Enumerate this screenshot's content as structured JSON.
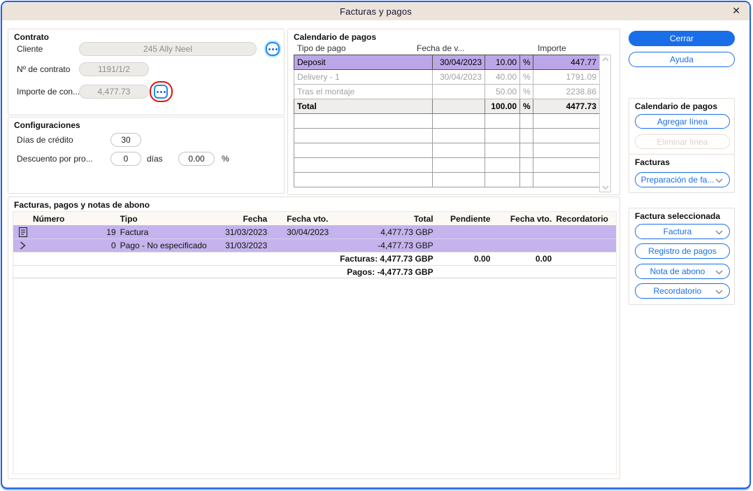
{
  "window": {
    "title": "Facturas y pagos"
  },
  "icons": {
    "close": "✕",
    "ellipsis_dots": "•••"
  },
  "contrato": {
    "label": "Contrato",
    "cliente": {
      "label": "Cliente",
      "value": "245 Ally Neel"
    },
    "num_contrato": {
      "label": "Nº de contrato",
      "value": "1191/1/2"
    },
    "importe": {
      "label": "Importe de con...",
      "value": "4,477.73"
    }
  },
  "configuraciones": {
    "label": "Configuraciones",
    "dias_credito": {
      "label": "Días de crédito",
      "value": "30"
    },
    "descuento": {
      "label": "Descuento por pro...",
      "dias": "0",
      "dias_suffix": "días",
      "pct": "0.00",
      "pct_suffix": "%"
    }
  },
  "calendario": {
    "label": "Calendario de pagos",
    "headers": {
      "tipo": "Tipo de pago",
      "fecha": "Fecha de v...",
      "importe": "Importe"
    },
    "rows": [
      {
        "tipo": "Deposit",
        "fecha": "30/04/2023",
        "pct": "10.00",
        "sign": "%",
        "importe": "447.77"
      },
      {
        "tipo": "Delivery - 1",
        "fecha": "30/04/2023",
        "pct": "40.00",
        "sign": "%",
        "importe": "1791.09"
      },
      {
        "tipo": "Tras el montaje",
        "fecha": "",
        "pct": "50.00",
        "sign": "%",
        "importe": "2238.86"
      },
      {
        "tipo": "Total",
        "fecha": "",
        "pct": "100.00",
        "sign": "%",
        "importe": "4477.73"
      }
    ]
  },
  "facturas": {
    "label": "Facturas, pagos y notas de abono",
    "headers": {
      "numero": "Número",
      "tipo": "Tipo",
      "fecha": "Fecha",
      "fecha_vto": "Fecha vto.",
      "total": "Total",
      "pendiente": "Pendiente",
      "fecha_vto2": "Fecha vto.",
      "recordatorio": "Recordatorio"
    },
    "rows": [
      {
        "numero": "19",
        "tipo": "Factura",
        "fecha": "31/03/2023",
        "fecha_vto": "30/04/2023",
        "total": "4,477.73 GBP"
      },
      {
        "numero": "0",
        "tipo": "Pago - No especificado",
        "fecha": "31/03/2023",
        "fecha_vto": "",
        "total": "-4,477.73 GBP"
      }
    ],
    "totals": [
      {
        "label": "Facturas: 4,477.73 GBP",
        "pendiente": "0.00",
        "fecha_vto": "0.00"
      },
      {
        "label": "Pagos: -4,477.73 GBP",
        "pendiente": "",
        "fecha_vto": ""
      }
    ]
  },
  "panel": {
    "cerrar": "Cerrar",
    "ayuda": "Ayuda",
    "calendario_group": {
      "label": "Calendario de pagos",
      "agregar": "Agregar línea",
      "eliminar": "Eliminar línea"
    },
    "facturas_group": {
      "label": "Facturas",
      "preparacion": "Preparación de fa..."
    },
    "seleccionada_group": {
      "label": "Factura seleccionada",
      "factura": "Factura",
      "registro": "Registro de pagos",
      "nota": "Nota de abono",
      "recordatorio": "Recordatorio"
    }
  },
  "colors": {
    "accent_blue": "#1a6ee8",
    "selection_purple": "#bba7e8",
    "row_purple": "#c4b3ec",
    "titlebar_beige": "#ece3da",
    "annotation_red": "#e01212"
  }
}
